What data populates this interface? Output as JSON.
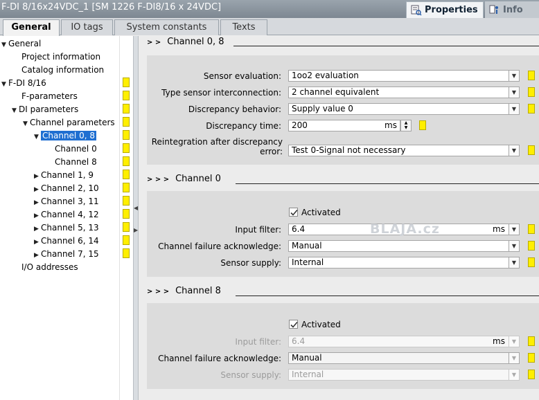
{
  "window": {
    "title": "F-DI 8/16x24VDC_1 [SM 1226 F-DI8/16 x 24VDC]",
    "properties_tab": "Properties",
    "info_tab": "Info"
  },
  "tabs": [
    "General",
    "IO tags",
    "System constants",
    "Texts"
  ],
  "tree": [
    {
      "label": "General",
      "expander": "▼"
    },
    {
      "label": "Project information",
      "expander": ""
    },
    {
      "label": "Catalog information",
      "expander": ""
    },
    {
      "label": "F-DI 8/16",
      "expander": "▼"
    },
    {
      "label": "F-parameters",
      "expander": ""
    },
    {
      "label": "DI parameters",
      "expander": "▼"
    },
    {
      "label": "Channel parameters",
      "expander": "▼"
    },
    {
      "label": "Channel 0, 8",
      "expander": "▼"
    },
    {
      "label": "Channel 0",
      "expander": ""
    },
    {
      "label": "Channel 8",
      "expander": ""
    },
    {
      "label": "Channel 1, 9",
      "expander": "▶"
    },
    {
      "label": "Channel 2, 10",
      "expander": "▶"
    },
    {
      "label": "Channel 3, 11",
      "expander": "▶"
    },
    {
      "label": "Channel 4, 12",
      "expander": "▶"
    },
    {
      "label": "Channel 5, 13",
      "expander": "▶"
    },
    {
      "label": "Channel 6, 14",
      "expander": "▶"
    },
    {
      "label": "Channel 7, 15",
      "expander": "▶"
    },
    {
      "label": "I/O addresses",
      "expander": ""
    }
  ],
  "section1": {
    "title": "Channel 0, 8",
    "chevrons": "> >",
    "sensor_evaluation_label": "Sensor evaluation:",
    "sensor_evaluation_value": "1oo2 evaluation",
    "type_sensor_label": "Type sensor interconnection:",
    "type_sensor_value": "2 channel equivalent",
    "discrepancy_behavior_label": "Discrepancy behavior:",
    "discrepancy_behavior_value": "Supply value 0",
    "discrepancy_time_label": "Discrepancy time:",
    "discrepancy_time_value": "200",
    "discrepancy_time_unit": "ms",
    "reintegration_label_line1": "Reintegration after discrepancy",
    "reintegration_label_line2": "error:",
    "reintegration_value": "Test 0-Signal not necessary"
  },
  "section2": {
    "title": "Channel 0",
    "chevrons": "> > >",
    "activated_label": "Activated",
    "activated": true,
    "input_filter_label": "Input filter:",
    "input_filter_value": "6.4",
    "input_filter_unit": "ms",
    "channel_failure_label": "Channel failure acknowledge:",
    "channel_failure_value": "Manual",
    "sensor_supply_label": "Sensor supply:",
    "sensor_supply_value": "Internal"
  },
  "section3": {
    "title": "Channel 8",
    "chevrons": "> > >",
    "activated_label": "Activated",
    "activated": true,
    "input_filter_label": "Input filter:",
    "input_filter_value": "6.4",
    "input_filter_unit": "ms",
    "channel_failure_label": "Channel failure acknowledge:",
    "channel_failure_value": "Manual",
    "sensor_supply_label": "Sensor supply:",
    "sensor_supply_value": "Internal"
  },
  "watermark": "BLAJA.cz",
  "colors": {
    "selection": "#1f6fd1",
    "flag": "#ffef00",
    "titlebar": "#8a949e"
  },
  "icons": {
    "properties": "properties-icon",
    "info": "info-icon",
    "dropdown": "chevron-down-icon"
  }
}
